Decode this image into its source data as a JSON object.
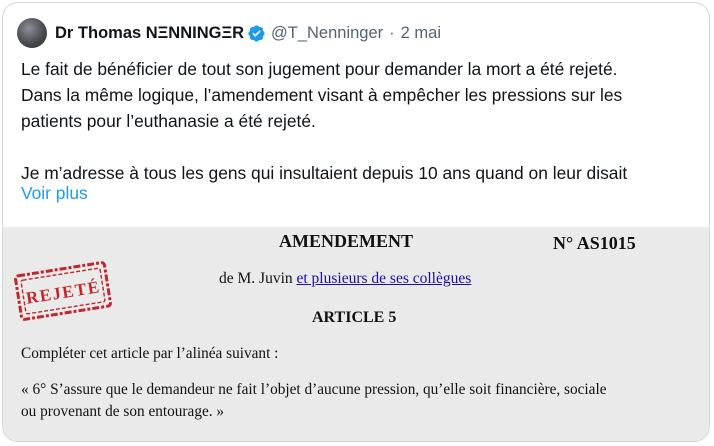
{
  "tweet": {
    "author": {
      "display_name": "Dr Thomas NΞNNINGΞR",
      "handle": "@T_Nenninger",
      "separator": "·",
      "date": "2 mai"
    },
    "text_lines": [
      "Le fait de bénéficier de tout son jugement pour demander la mort a été rejeté.",
      "Dans la même logique, l’amendement visant à empêcher les pressions sur les",
      "patients pour l’euthanasie a été rejeté.",
      "Je m’adresse à tous les gens qui insultaient depuis 10 ans quand on leur disait"
    ],
    "see_more_label": "Voir plus",
    "verified_icon": "verified-badge-icon",
    "colors": {
      "link": "#1d9bf0",
      "verified": "#1d9bf0",
      "stamp": "#c0272d",
      "muted": "#536471"
    }
  },
  "document": {
    "title": "AMENDEMENT",
    "number": "N° AS1015",
    "author_prefix": "de M. Juvin",
    "author_link": "et plusieurs de ses collègues",
    "article": "ARTICLE 5",
    "instruction": "Compléter cet article par l’alinéa suivant :",
    "body_line1": "« 6° S’assure que le demandeur ne fait l’objet d’aucune pression, qu’elle soit financière, sociale",
    "body_line2": "ou provenant de son entourage. »",
    "stamp_text": "REJETÉ"
  }
}
